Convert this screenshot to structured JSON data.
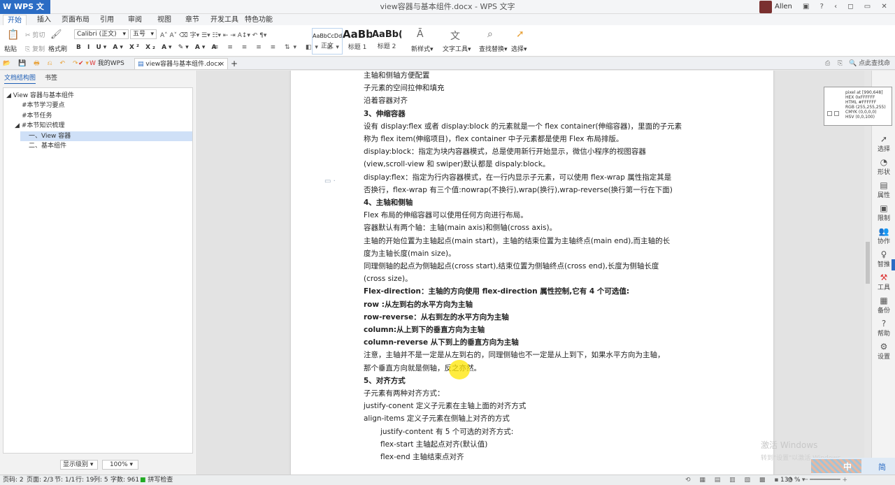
{
  "app": {
    "name": "WPS 文字",
    "title": "view容器与基本组件.docx - WPS 文字",
    "user": "Allen"
  },
  "ribbon_tabs": [
    "开始",
    "插入",
    "页面布局",
    "引用",
    "审阅",
    "视图",
    "章节",
    "开发工具",
    "特色功能"
  ],
  "ribbon": {
    "paste": "粘贴",
    "cut": "剪切",
    "copy": "复制",
    "format_painter": "格式刷",
    "font": "Calibri (正文)",
    "size": "五号",
    "style_normal": "正文",
    "style_h1": "标题 1",
    "style_h2": "标题 2",
    "style_preview1": "AaBbCcDd",
    "style_preview2": "AaBb",
    "style_preview3": "AaBb(",
    "new_style": "新样式",
    "text_tools": "文字工具",
    "find_replace": "查找替换",
    "select": "选择"
  },
  "doctabs": {
    "my_wps": "我的WPS",
    "doc": "view容器与基本组件.docx",
    "search": "点此查找命令"
  },
  "nav": {
    "tab_outline": "文档结构图",
    "tab_bookmark": "书签",
    "tree": [
      "View 容器与基本组件",
      "#本节学习要点",
      "#本节任务",
      "#本节知识梳理",
      "一、View 容器",
      "二、基本组件"
    ],
    "display_level": "显示级别",
    "zoom": "100%"
  },
  "doc": {
    "lines": [
      {
        "t": "主轴和侧轴方便配置"
      },
      {
        "t": "子元素的空间拉伸和填充"
      },
      {
        "t": "沿着容器对齐"
      },
      {
        "t": "3、伸缩容器",
        "cls": "h"
      },
      {
        "t": "设有 display:flex 或者 display:block 的元素就是一个 flex container(伸缩容器)，里面的子元素"
      },
      {
        "t": "称为 flex item(伸缩项目)，flex container 中子元素都是使用 Flex 布局排版。"
      },
      {
        "t": "display:block：指定为块内容器模式，总是使用新行开始显示，微信小程序的视图容器"
      },
      {
        "t": "(view,scroll-view 和 swiper)默认都是 dispaly:block。"
      },
      {
        "t": "display:flex：指定为行内容器模式，在一行内显示子元素，可以使用 flex-wrap 属性指定其是"
      },
      {
        "t": "否换行，flex-wrap 有三个值:nowrap(不换行),wrap(换行),wrap-reverse(换行第一行在下面)"
      },
      {
        "t": "4、主轴和侧轴",
        "cls": "h"
      },
      {
        "t": "Flex 布局的伸缩容器可以使用任何方向进行布局。"
      },
      {
        "t": "容器默认有两个轴：主轴(main axis)和侧轴(cross axis)。"
      },
      {
        "t": "主轴的开始位置为主轴起点(main start)，主轴的结束位置为主轴终点(main end),而主轴的长"
      },
      {
        "t": "度为主轴长度(main size)。"
      },
      {
        "t": "同理侧轴的起点为侧轴起点(cross start),结束位置为侧轴终点(cross end),长度为侧轴长度"
      },
      {
        "t": "(cross size)。"
      },
      {
        "t": "Flex-direction：主轴的方向使用 flex-direction 属性控制,它有 4 个可选值:",
        "cls": "b"
      },
      {
        "t": "row :从左到右的水平方向为主轴",
        "cls": "b"
      },
      {
        "t": "row-reverse：从右到左的水平方向为主轴",
        "cls": "b"
      },
      {
        "t": "column:从上到下的垂直方向为主轴",
        "cls": "b"
      },
      {
        "t": "column-reverse 从下到上的垂直方向为主轴",
        "cls": "b"
      },
      {
        "t": "注意，主轴并不是一定是从左到右的，同理侧轴也不一定是从上到下，如果水平方向为主轴，"
      },
      {
        "t": "那个垂直方向就是侧轴，反之亦然。"
      },
      {
        "t": "5、对齐方式",
        "cls": "h"
      },
      {
        "t": "子元素有两种对齐方式："
      },
      {
        "t": "justify-conent  定义子元素在主轴上面的对齐方式",
        "ul": "justify-conent"
      },
      {
        "t": "align-items  定义子元素在侧轴上对齐的方式"
      },
      {
        "t": "justify-content 有 5 个可选的对齐方式:",
        "cls": "ind"
      },
      {
        "t": "flex-start  主轴起点对齐(默认值)",
        "cls": "ind"
      },
      {
        "t": "flex-end  主轴结束点对齐",
        "cls": "ind"
      }
    ]
  },
  "sidebar": [
    "选择",
    "形状",
    "属性",
    "限制",
    "协作",
    "智推",
    "工具",
    "备份",
    "帮助",
    "设置"
  ],
  "pixel": {
    "l1": "pixel at [990,648]",
    "l2": "HEX 0xFFFFFF",
    "l3": "HTML #FFFFFF",
    "l4": "RGB (255,255,255)",
    "l5": "CMYK (0,0,0,0)",
    "l6": "HSV (0,0,100)"
  },
  "status": {
    "page_num": "页码: 2",
    "pages": "页面: 2/3",
    "section": "节: 1/1",
    "row": "行: 19",
    "col": "列: 5",
    "words": "字数: 961",
    "spell": "拼写检查",
    "zoom": "130 %"
  },
  "watermark": {
    "l1": "激活 Windows",
    "l2": "转到\"设置\"以激活 Windows。"
  },
  "ime": {
    "mode": "中",
    "extra": "简"
  }
}
